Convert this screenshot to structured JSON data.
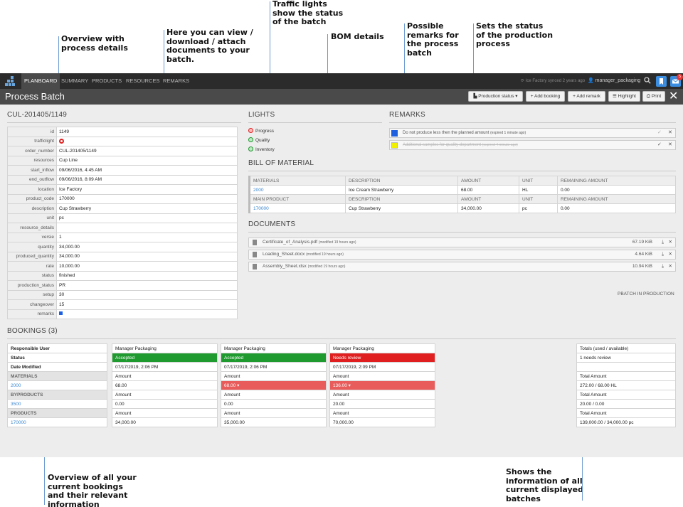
{
  "annotations": {
    "overview": [
      "Overview with",
      "process details"
    ],
    "documents": [
      "Here you can view /",
      "download / attach",
      "documents to your",
      "batch."
    ],
    "traffic": [
      "Traffic lights",
      "show the status",
      "of the batch"
    ],
    "bom": [
      "BOM details"
    ],
    "remarks": [
      "Possible",
      "remarks for",
      "the process",
      "batch"
    ],
    "status": [
      "Sets the status",
      "of the production",
      "process"
    ],
    "bookings": [
      "Overview of all your",
      "current bookings",
      "and their relevant",
      "information"
    ],
    "totals": [
      "Shows the",
      "information of all",
      "current displayed",
      "batches"
    ]
  },
  "nav": {
    "items": [
      "PLANBOARD",
      "SUMMARY",
      "PRODUCTS",
      "RESOURCES",
      "REMARKS"
    ],
    "synced": "Ice Factory synced 2 years ago",
    "user": "manager_packaging",
    "mail_count": "5"
  },
  "title": {
    "text": "Process Batch",
    "production_status": "Production status",
    "add_booking": "+ Add booking",
    "add_remark": "+ Add remark",
    "highlight": "Highlight",
    "print": "Print"
  },
  "batch": {
    "id": "CUL-201405/1149",
    "fields": [
      {
        "k": "id",
        "v": "1149"
      },
      {
        "k": "trafficlight",
        "v": ""
      },
      {
        "k": "order_number",
        "v": "CUL-201405/1149"
      },
      {
        "k": "resources",
        "v": "Cup Line"
      },
      {
        "k": "start_inflow",
        "v": "09/06/2016, 4:45 AM"
      },
      {
        "k": "end_outflow",
        "v": "09/06/2016, 8:09 AM"
      },
      {
        "k": "location",
        "v": "Ice Factory"
      },
      {
        "k": "product_code",
        "v": "170000"
      },
      {
        "k": "description",
        "v": "Cup Strawberry"
      },
      {
        "k": "unit",
        "v": "pc"
      },
      {
        "k": "resource_details",
        "v": ""
      },
      {
        "k": "versie",
        "v": "1"
      },
      {
        "k": "quantity",
        "v": "34,000.00"
      },
      {
        "k": "produced_quantity",
        "v": "34,000.00"
      },
      {
        "k": "rate",
        "v": "10,000.00"
      },
      {
        "k": "status",
        "v": "finished"
      },
      {
        "k": "production_status",
        "v": "PR"
      },
      {
        "k": "setup",
        "v": "30"
      },
      {
        "k": "changeover",
        "v": "15"
      },
      {
        "k": "remarks",
        "v": ""
      }
    ]
  },
  "lights": {
    "title": "LIGHTS",
    "items": [
      {
        "label": "Progress",
        "color": "#e02020"
      },
      {
        "label": "Quality",
        "color": "#1e9a2e"
      },
      {
        "label": "Inventory",
        "color": "#1e9a2e"
      }
    ]
  },
  "remarks": {
    "title": "REMARKS",
    "items": [
      {
        "text": "Do not produce less then the planned amount",
        "note": "(expired 1 minute ago)",
        "color": "#1e5fe0"
      },
      {
        "text": "Additional samples for quality department",
        "note": "(expired 4 minute ago)",
        "color": "#f0f000"
      }
    ]
  },
  "bom": {
    "title": "BILL OF MATERIAL",
    "headers": [
      "MATERIALS",
      "DESCRIPTION",
      "AMOUNT",
      "UNIT",
      "REMAINING AMOUNT"
    ],
    "row1": [
      "2000",
      "Ice Cream Strawberry",
      "68.00",
      "HL",
      "0.00"
    ],
    "headers2": [
      "MAIN PRODUCT",
      "DESCRIPTION",
      "AMOUNT",
      "UNIT",
      "REMAINING AMOUNT"
    ],
    "row2": [
      "170000",
      "Cup Strawberry",
      "34,000.00",
      "pc",
      "0.00"
    ]
  },
  "documents": {
    "title": "DOCUMENTS",
    "items": [
      {
        "name": "Certificate_of_Analysis.pdf",
        "mod": "(modified 19 hours ago)",
        "size": "67.19 KiB"
      },
      {
        "name": "Loading_Sheet.docx",
        "mod": "(modified 19 hours ago)",
        "size": "4.64 KiB"
      },
      {
        "name": "Assembly_Sheet.xlsx",
        "mod": "(modified 19 hours ago)",
        "size": "10.94 KiB"
      }
    ],
    "footer": "PBATCH IN PRODUCTION"
  },
  "bookings": {
    "title": "BOOKINGS (3)",
    "labels": [
      "Responsible User",
      "Status",
      "Date Modified",
      "MATERIALS",
      "2000",
      "BYPRODUCTS",
      "3500",
      "PRODUCTS",
      "170000"
    ],
    "cols": [
      {
        "user": "Manager Packaging",
        "status": "Accepted",
        "date": "07/17/2019, 2:06 PM",
        "m": "68.00",
        "b": "0.00",
        "p": "34,000.00"
      },
      {
        "user": "Manager Packaging",
        "status": "Accepted",
        "date": "07/17/2019, 2:06 PM",
        "m": "68.00 ▾",
        "b": "0.00",
        "p": "35,000.00"
      },
      {
        "user": "Manager Packaging",
        "status": "Needs review",
        "date": "07/17/2019, 2:09 PM",
        "m": "136.00 ▾",
        "b": "20.00",
        "p": "70,000.00"
      }
    ],
    "amount": "Amount",
    "totals": {
      "head": "Totals (used / available)",
      "review": "1 needs review",
      "ta": "Total Amount",
      "m": "272.00 / 68.00 HL",
      "b": "20.00 / 0.00",
      "p": "139,000.00 / 34,000.00 pc"
    }
  }
}
